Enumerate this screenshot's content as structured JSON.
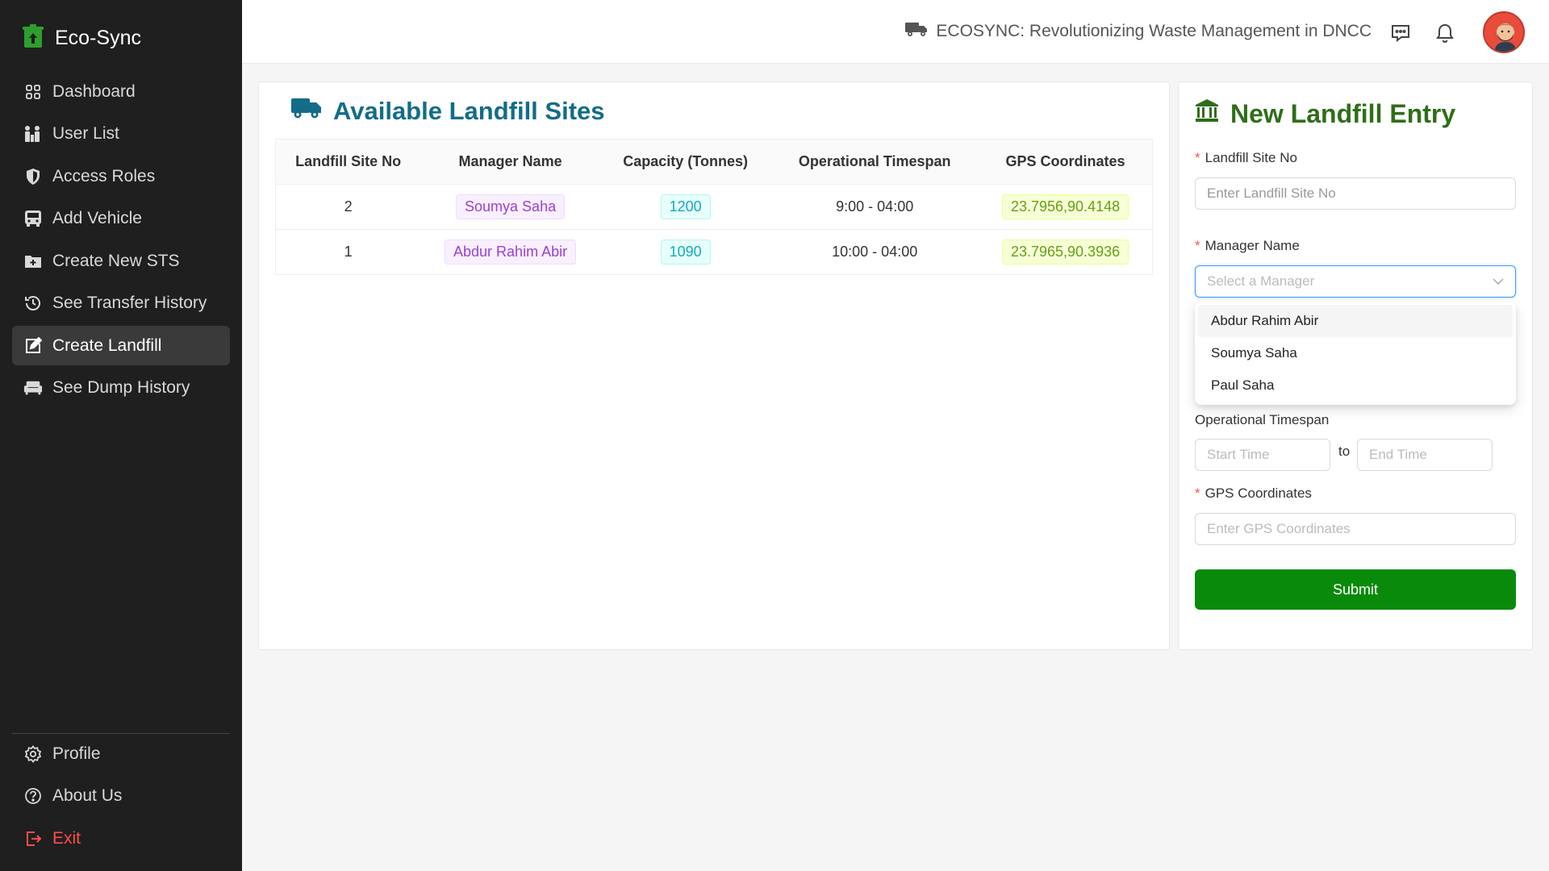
{
  "app": {
    "name": "Eco-Sync"
  },
  "sidebar": {
    "items": [
      {
        "label": "Dashboard",
        "icon": "dashboard-grid-icon"
      },
      {
        "label": "User List",
        "icon": "users-icon"
      },
      {
        "label": "Access Roles",
        "icon": "shield-icon"
      },
      {
        "label": "Add Vehicle",
        "icon": "bus-icon"
      },
      {
        "label": "Create New STS",
        "icon": "folder-plus-icon"
      },
      {
        "label": "See Transfer History",
        "icon": "history-icon"
      },
      {
        "label": "Create Landfill",
        "icon": "edit-square-icon",
        "active": true
      },
      {
        "label": "See Dump History",
        "icon": "couch-icon"
      }
    ],
    "bottom": [
      {
        "label": "Profile",
        "icon": "gear-icon"
      },
      {
        "label": "About Us",
        "icon": "question-circle-icon"
      },
      {
        "label": "Exit",
        "icon": "logout-icon"
      }
    ]
  },
  "header": {
    "title": "ECOSYNC: Revolutionizing Waste Management in DNCC",
    "icons": [
      "truck-icon",
      "message-icon",
      "bell-icon",
      "avatar"
    ]
  },
  "landfill_table": {
    "title": "Available Landfill Sites",
    "columns": [
      "Landfill Site No",
      "Manager Name",
      "Capacity (Tonnes)",
      "Operational Timespan",
      "GPS Coordinates"
    ],
    "rows": [
      {
        "site_no": "2",
        "manager": "Soumya Saha",
        "capacity": "1200",
        "timespan": "9:00 - 04:00",
        "gps": "23.7956,90.4148"
      },
      {
        "site_no": "1",
        "manager": "Abdur Rahim Abir",
        "capacity": "1090",
        "timespan": "10:00 - 04:00",
        "gps": "23.7965,90.3936"
      }
    ]
  },
  "form": {
    "title": "New Landfill Entry",
    "site_no": {
      "label": "Landfill Site No",
      "placeholder": "Enter Landfill Site No"
    },
    "manager": {
      "label": "Manager Name",
      "placeholder": "Select a Manager",
      "options": [
        "Abdur Rahim Abir",
        "Soumya Saha",
        "Paul Saha"
      ]
    },
    "timespan": {
      "label": "Operational Timespan",
      "start_placeholder": "Start Time",
      "to": "to",
      "end_placeholder": "End Time"
    },
    "gps": {
      "label": "GPS Coordinates",
      "placeholder": "Enter GPS Coordinates"
    },
    "submit_label": "Submit"
  },
  "colors": {
    "sidebar_bg": "#1f1f1f",
    "table_title": "#136c88",
    "form_title": "#2f6e1a",
    "submit_bg": "#0a8a0a",
    "exit": "#ff4d4f"
  }
}
